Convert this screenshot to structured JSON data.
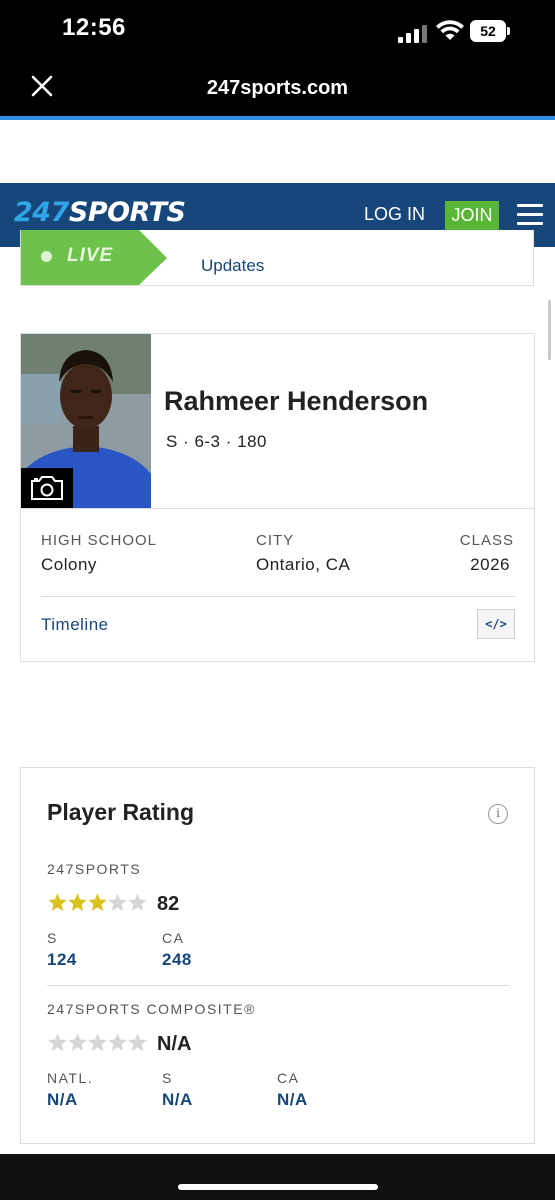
{
  "status_bar": {
    "time": "12:56",
    "battery": "52"
  },
  "browser": {
    "url": "247sports.com"
  },
  "site_nav": {
    "logo_num": "247",
    "logo_word": "SPORTS",
    "login": "LOG IN",
    "join": "JOIN"
  },
  "live": {
    "badge": "LIVE",
    "link_text": "Updates"
  },
  "player": {
    "name": "Rahmeer Henderson",
    "meta": "S · 6-3 · 180",
    "high_school_label": "HIGH SCHOOL",
    "high_school": "Colony",
    "city_label": "CITY",
    "city": "Ontario, CA",
    "class_label": "CLASS",
    "class": "2026",
    "timeline": "Timeline",
    "embed": "</>"
  },
  "rating": {
    "title": "Player Rating",
    "info": "i",
    "s247": {
      "label": "247SPORTS",
      "stars_filled": 3,
      "stars_total": 5,
      "score": "82",
      "pos_label": "S",
      "pos_rank": "124",
      "state_label": "CA",
      "state_rank": "248"
    },
    "composite": {
      "label": "247SPORTS COMPOSITE®",
      "stars_filled": 0,
      "stars_total": 5,
      "score": "N/A",
      "natl_label": "NATL.",
      "natl": "N/A",
      "pos_label": "S",
      "pos": "N/A",
      "state_label": "CA",
      "state": "N/A"
    }
  },
  "colors": {
    "nav_blue": "#17467b",
    "accent_green": "#59b535",
    "live_green": "#6cc24a",
    "star_gold": "#d9c21f",
    "star_empty": "#d6d6d6"
  }
}
